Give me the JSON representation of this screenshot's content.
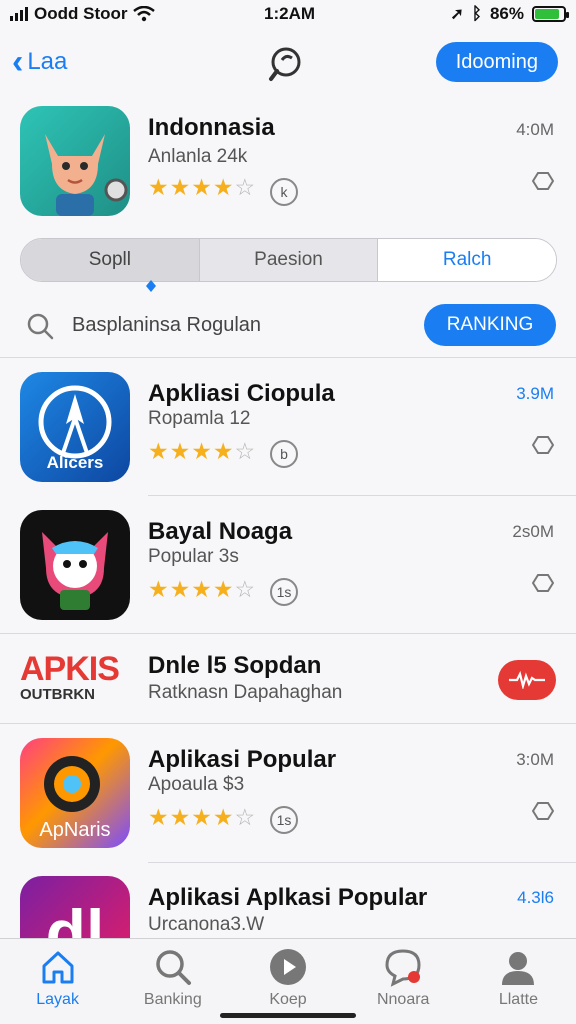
{
  "status": {
    "carrier": "Oodd Stoor",
    "time": "1:2AM",
    "battery": "86%"
  },
  "nav": {
    "back_label": "Laa",
    "action_label": "Idooming"
  },
  "featured": {
    "title": "Indonnasia",
    "subtitle": "Anlanla 24k",
    "size": "4:0M",
    "rating": 4,
    "badge": "k"
  },
  "segments": [
    "Sopll",
    "Paesion",
    "Ralch"
  ],
  "search": {
    "query": "Basplaninsa Rogulan",
    "ranking_label": "RANKING"
  },
  "apps": [
    {
      "title": "Apkliasi Ciopula",
      "subtitle": "Ropamla 12",
      "size": "3.9M",
      "rating": 4,
      "badge": "b",
      "icon_text": "Alicers"
    },
    {
      "title": "Bayal Noaga",
      "subtitle": "Popular 3s",
      "size": "2s0M",
      "rating": 4,
      "badge": "1s"
    },
    {
      "title": "Dnle l5 Sopdan",
      "subtitle": "Ratknasn Dapahaghan",
      "icon_text": "APKIS",
      "icon_sub": "OUTBRKN"
    },
    {
      "title": "Aplikasi Popular",
      "subtitle": "Apoaula $3",
      "size": "3:0M",
      "rating": 4,
      "badge": "1s",
      "icon_text": "ApNaris"
    },
    {
      "title": "Aplikasi Aplkasi Popular",
      "subtitle": "Urcanona3.W",
      "size": "4.3l6",
      "icon_text": "dl"
    }
  ],
  "tabs": [
    {
      "label": "Layak",
      "icon": "home-icon"
    },
    {
      "label": "Banking",
      "icon": "search-icon"
    },
    {
      "label": "Koep",
      "icon": "play-icon"
    },
    {
      "label": "Nnoara",
      "icon": "chat-icon"
    },
    {
      "label": "Llatte",
      "icon": "person-icon"
    }
  ],
  "colors": {
    "accent": "#1a7ef2",
    "star": "#f6b01e",
    "alert": "#e53935"
  }
}
